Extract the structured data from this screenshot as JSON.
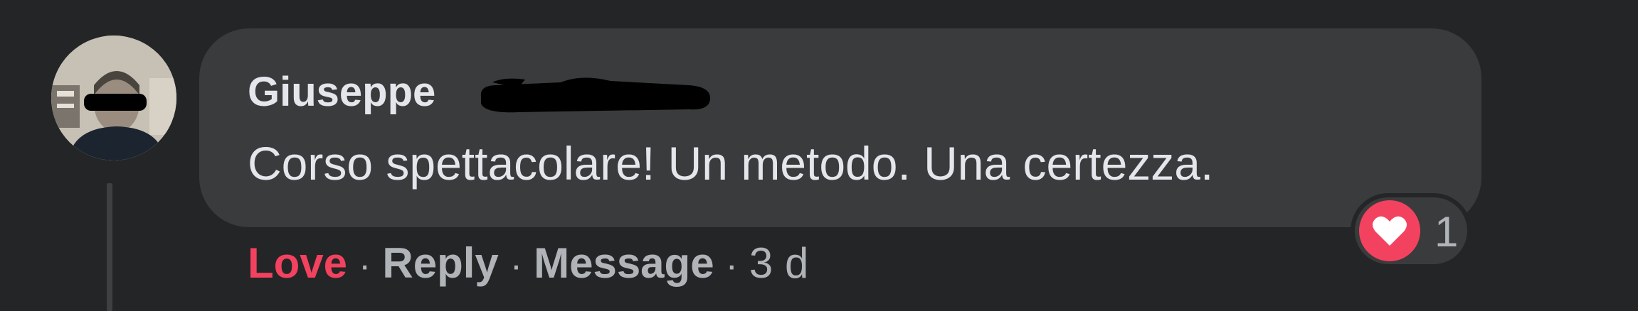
{
  "comment": {
    "author_name": "Giuseppe",
    "author_surname_redacted": true,
    "text": "Corso spettacolare! Un metodo. Una certezza.",
    "reaction": {
      "icon": "heart-icon",
      "color": "#f3425f",
      "count": "1"
    },
    "actions": {
      "love_label": "Love",
      "reply_label": "Reply",
      "message_label": "Message",
      "separator": "·",
      "timestamp": "3 d"
    }
  },
  "colors": {
    "background": "#242526",
    "bubble": "#3a3b3c",
    "primary_text": "#e4e6eb",
    "secondary_text": "#b0b3b8",
    "love": "#f3425f"
  }
}
